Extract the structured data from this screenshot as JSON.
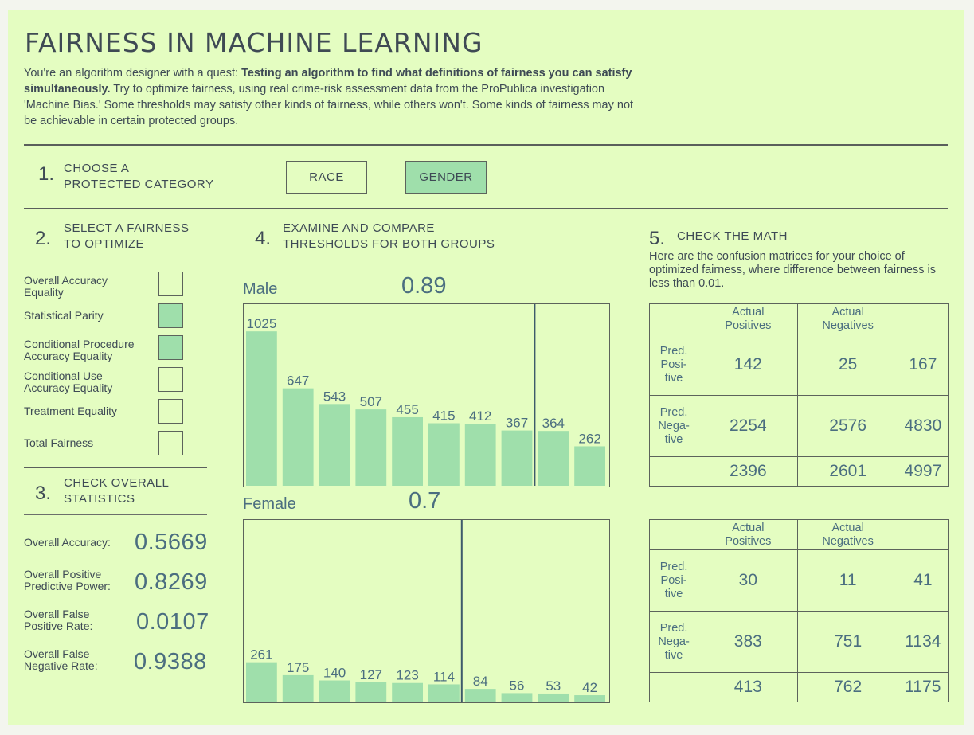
{
  "title": "FAIRNESS IN MACHINE LEARNING",
  "intro": {
    "lead": "You're an algorithm designer with a quest: ",
    "bold": "Testing an algorithm to find what definitions of fairness you can satisfy simultaneously.",
    "rest": " Try to optimize fairness, using real crime-risk assessment data from the ProPublica investigation 'Machine Bias.' Some thresholds may satisfy other kinds of fairness, while others won't. Some kinds of fairness may not be achievable in certain protected groups."
  },
  "step1": {
    "num": "1.",
    "label_line1": "CHOOSE A",
    "label_line2": "PROTECTED CATEGORY",
    "buttons": [
      {
        "label": "RACE",
        "selected": false
      },
      {
        "label": "GENDER",
        "selected": true
      }
    ]
  },
  "step2": {
    "num": "2.",
    "label_line1": "SELECT A FAIRNESS",
    "label_line2": "TO OPTIMIZE",
    "options": [
      {
        "line1": "Overall Accuracy",
        "line2": "Equality",
        "selected": false
      },
      {
        "line1": "Statistical Parity",
        "line2": "",
        "selected": true
      },
      {
        "line1": "Conditional Procedure",
        "line2": "Accuracy Equality",
        "selected": true
      },
      {
        "line1": "Conditional Use",
        "line2": "Accuracy Equality",
        "selected": false
      },
      {
        "line1": "Treatment Equality",
        "line2": "",
        "selected": false
      },
      {
        "line1": "Total Fairness",
        "line2": "",
        "selected": false
      }
    ]
  },
  "step3": {
    "num": "3.",
    "label_line1": "CHECK OVERALL",
    "label_line2": "STATISTICS",
    "stats": [
      {
        "line1": "Overall Accuracy:",
        "line2": "",
        "value": "0.5669"
      },
      {
        "line1": "Overall Positive",
        "line2": "Predictive Power:",
        "value": "0.8269"
      },
      {
        "line1": "Overall False",
        "line2": "Positive Rate:",
        "value": "0.0107"
      },
      {
        "line1": "Overall False",
        "line2": "Negative Rate:",
        "value": "0.9388"
      }
    ]
  },
  "step4": {
    "num": "4.",
    "label_line1": "EXAMINE AND COMPARE",
    "label_line2": "THRESHOLDS FOR BOTH GROUPS",
    "groups": [
      {
        "name": "Male",
        "threshold": "0.89"
      },
      {
        "name": "Female",
        "threshold": "0.7"
      }
    ]
  },
  "step5": {
    "num": "5.",
    "label": "CHECK THE MATH",
    "description": "Here are the confusion matrices for your choice of optimized fairness, where difference between fairness is less than 0.01.",
    "col_headers": [
      "Actual Positives",
      "Actual Negatives"
    ],
    "row_headers": [
      [
        "Pred.",
        "Posi-",
        "tive"
      ],
      [
        "Pred.",
        "Nega-",
        "tive"
      ]
    ],
    "matrices": [
      {
        "rows": [
          [
            "142",
            "25",
            "167"
          ],
          [
            "2254",
            "2576",
            "4830"
          ],
          [
            "2396",
            "2601",
            "4997"
          ]
        ]
      },
      {
        "rows": [
          [
            "30",
            "11",
            "41"
          ],
          [
            "383",
            "751",
            "1134"
          ],
          [
            "413",
            "762",
            "1175"
          ]
        ]
      }
    ]
  },
  "colors": {
    "accent": "#9fdfab",
    "background": "#e4fdc1",
    "value_text": "#4b6e80"
  },
  "chart_data": [
    {
      "type": "bar",
      "series": [
        {
          "name": "Male",
          "values": [
            1025,
            647,
            543,
            507,
            455,
            415,
            412,
            367,
            364,
            262
          ]
        }
      ],
      "threshold": 0.89,
      "ylim": [
        0,
        1100
      ]
    },
    {
      "type": "bar",
      "series": [
        {
          "name": "Female",
          "values": [
            261,
            175,
            140,
            127,
            123,
            114,
            84,
            56,
            53,
            42
          ]
        }
      ],
      "threshold": 0.7,
      "ylim": [
        0,
        1100
      ]
    }
  ]
}
